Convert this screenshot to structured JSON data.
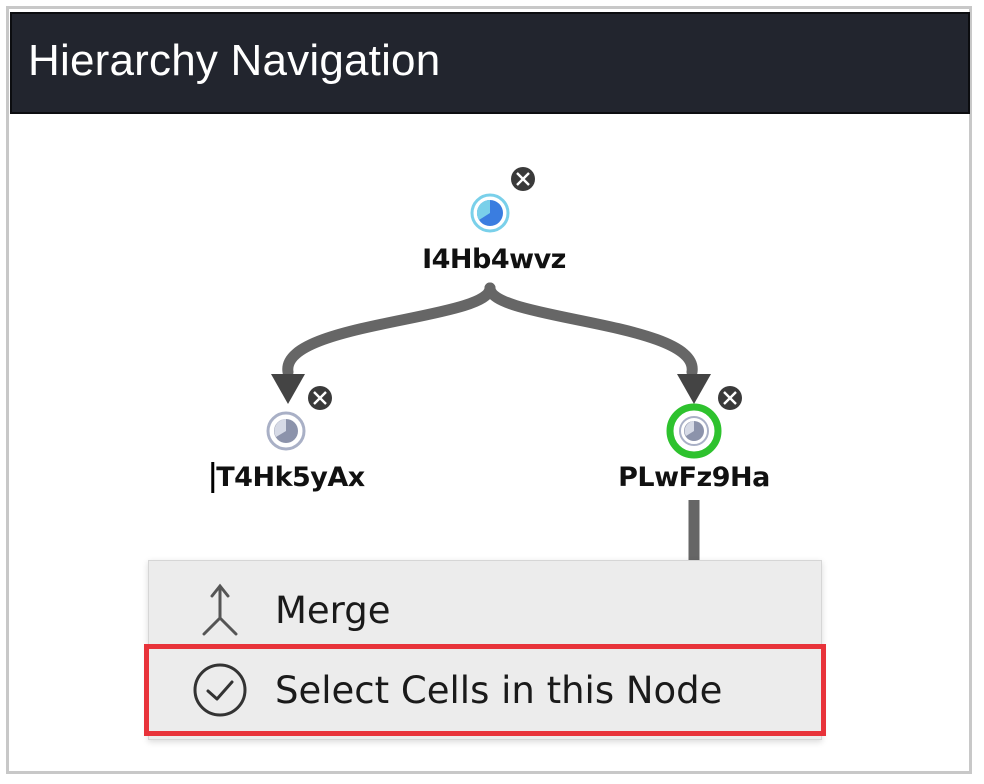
{
  "panel": {
    "title": "Hierarchy Navigation"
  },
  "tree": {
    "nodes": [
      {
        "id": "root",
        "label": "I4Hb4wvz",
        "selected": false,
        "status_color": "#3a7de0"
      },
      {
        "id": "left",
        "label": "T4Hk5yAx",
        "selected": false,
        "status_color": "#a9b0c6"
      },
      {
        "id": "right",
        "label": "PLwFz9Ha",
        "selected": true,
        "status_color": "#a9b0c6",
        "selection_color": "#2ec22e"
      }
    ]
  },
  "context_menu": {
    "items": [
      {
        "label": "Merge",
        "icon": "merge-icon"
      },
      {
        "label": "Select Cells in this Node",
        "icon": "check-circle-icon",
        "highlighted": true
      }
    ],
    "highlight_color": "#e8333a"
  },
  "colors": {
    "titlebar": "#22252e",
    "edge": "#666666",
    "remove_button": "#3a3a3a"
  }
}
